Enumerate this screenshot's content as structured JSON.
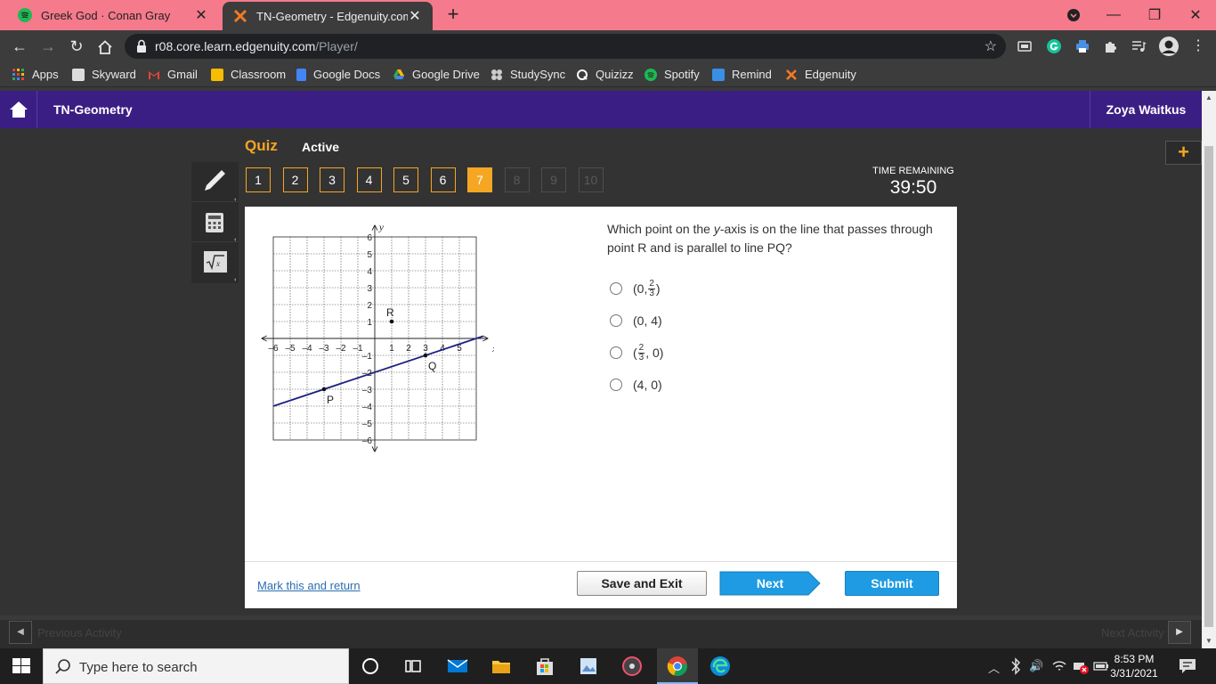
{
  "browser": {
    "tabs": [
      {
        "title": "Greek God · Conan Gray",
        "active": false
      },
      {
        "title": "TN-Geometry - Edgenuity.com",
        "active": true
      }
    ],
    "url_host": "r08.core.learn.edgenuity.com",
    "url_path": "/Player/",
    "bookmarks": [
      "Apps",
      "Skyward",
      "Gmail",
      "Classroom",
      "Google Docs",
      "Google Drive",
      "StudySync",
      "Quizizz",
      "Spotify",
      "Remind",
      "Edgenuity"
    ]
  },
  "app": {
    "course": "TN-Geometry",
    "user": "Zoya Waitkus"
  },
  "quiz": {
    "label": "Quiz",
    "status": "Active",
    "questions": [
      "1",
      "2",
      "3",
      "4",
      "5",
      "6",
      "7",
      "8",
      "9",
      "10"
    ],
    "current_question": "7",
    "timer_label": "TIME REMAINING",
    "timer_value": "39:50",
    "question_pre": "Which point on the ",
    "question_italic": "y",
    "question_post": "-axis is on the line that passes through point R and is parallel to line PQ?",
    "answers": {
      "a": {
        "open": "(0, ",
        "num": "2",
        "den": "3",
        "close": ")"
      },
      "b": {
        "text": "(0, 4)"
      },
      "c": {
        "open": "(",
        "num": "2",
        "den": "3",
        "close": ", 0)"
      },
      "d": {
        "text": "(4, 0)"
      }
    },
    "mark_return": "Mark this and return",
    "save_exit": "Save and Exit",
    "next": "Next",
    "submit": "Submit"
  },
  "graph": {
    "axis_x_label": "x",
    "axis_y_label": "y",
    "x_ticks": [
      "–6",
      "–5",
      "–4",
      "–3",
      "–2",
      "–1",
      "1",
      "2",
      "3",
      "4",
      "5"
    ],
    "y_ticks": [
      "6",
      "5",
      "4",
      "3",
      "2",
      "1",
      "–1",
      "–2",
      "–3",
      "–4",
      "–5",
      "–6"
    ],
    "point_labels": {
      "p": "P",
      "q": "Q",
      "r": "R"
    },
    "points": {
      "P": [
        -3,
        -3
      ],
      "Q": [
        3,
        -1
      ],
      "R": [
        1,
        1
      ]
    },
    "line_color": "#1a237e"
  },
  "activity_nav": {
    "prev": "Previous Activity",
    "next": "Next Activity"
  },
  "taskbar": {
    "search_placeholder": "Type here to search",
    "time": "8:53 PM",
    "date": "3/31/2021"
  }
}
